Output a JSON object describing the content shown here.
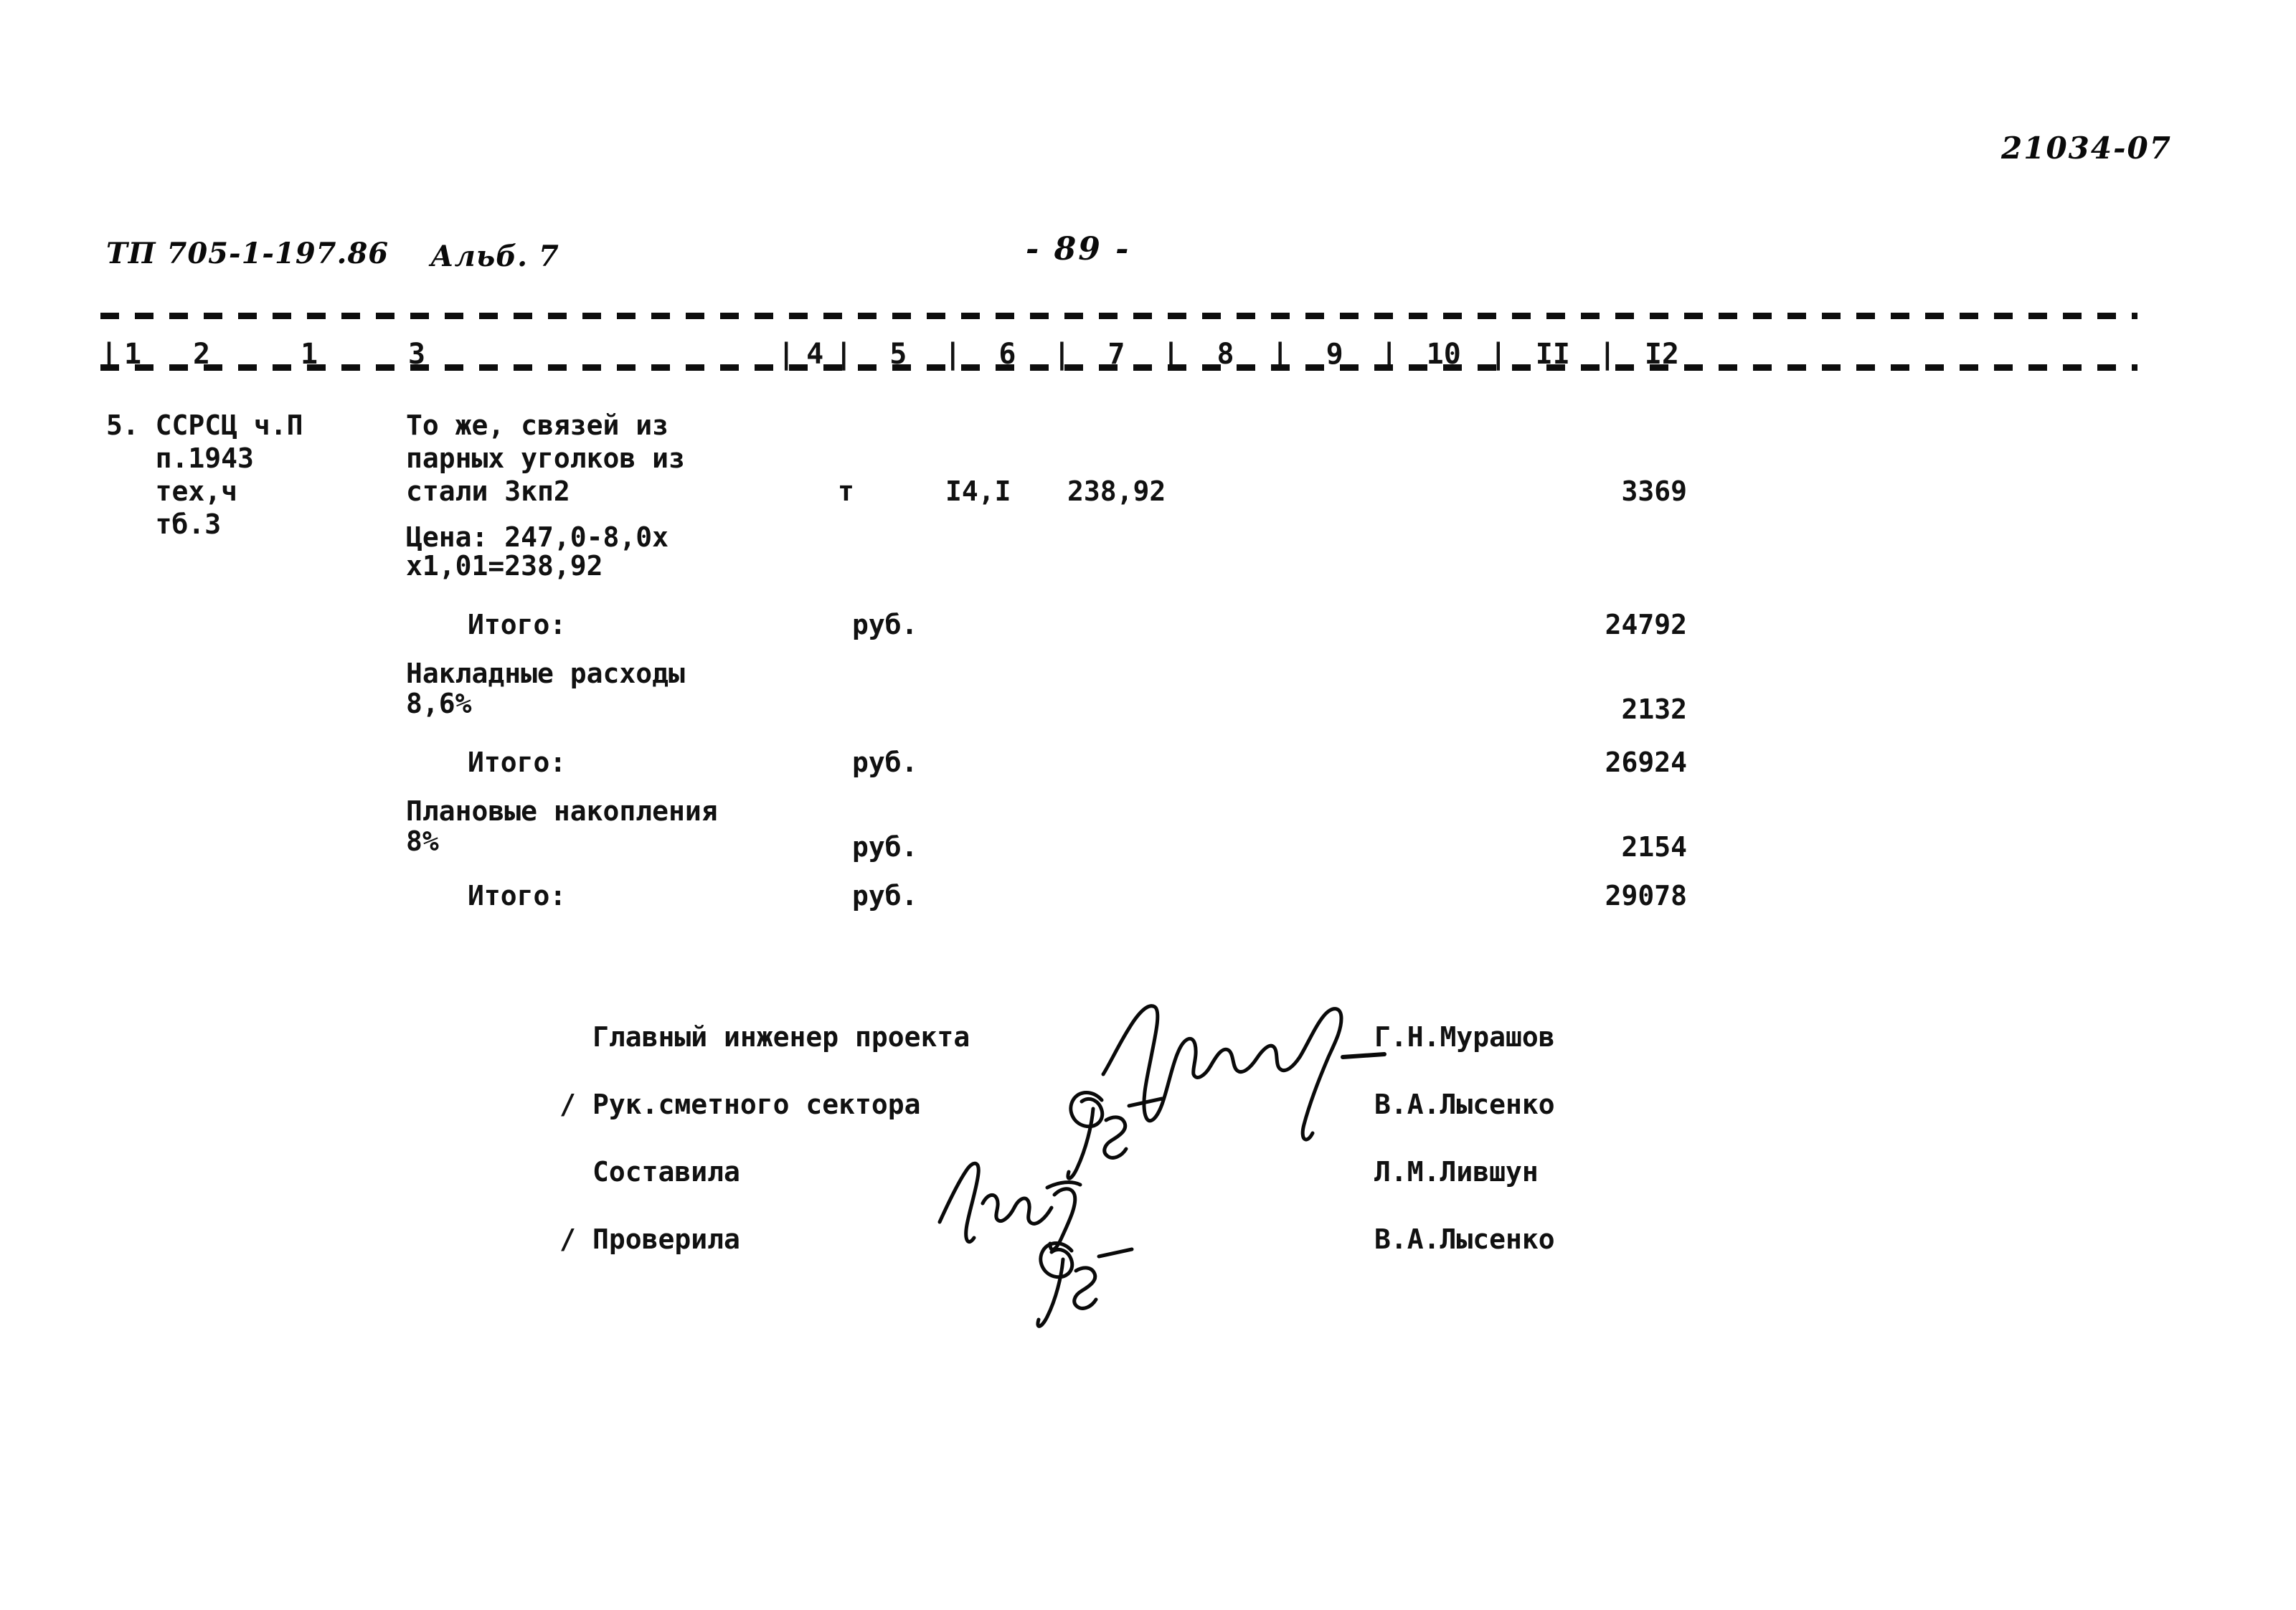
{
  "document": {
    "project_stamp": "ТП 705-1-197.86",
    "album_stamp": "Альб. 7",
    "page_marker": "- 89 -",
    "archive_number": "21034-07"
  },
  "table": {
    "column_numbers": [
      "1",
      "2",
      "1",
      "3",
      "4",
      "5",
      "6",
      "7",
      "8",
      "9",
      "10",
      "II",
      "I2"
    ],
    "separator": "|",
    "rows": [
      {
        "ref": [
          "5. ССРСЦ ч.П",
          "   п.1943",
          "   тех,ч",
          "   тб.3"
        ],
        "description": [
          "То же, связей из",
          "парных уголков из",
          "стали 3кп2"
        ],
        "price_note": [
          "Цена: 247,0-8,0х",
          "х1,01=238,92"
        ],
        "unit": "т",
        "quantity": "I4,I",
        "price": "238,92",
        "amount": "3369"
      }
    ],
    "summary": [
      {
        "label": "Итого:",
        "indent": true,
        "unit": "руб.",
        "amount": "24792"
      },
      {
        "label": "Накладные расходы",
        "sublabel": "8,6%",
        "indent": false,
        "unit": "",
        "amount": "2132"
      },
      {
        "label": "Итого:",
        "indent": true,
        "unit": "руб.",
        "amount": "26924"
      },
      {
        "label": "Плановые накопления",
        "sublabel": "8%",
        "indent": false,
        "unit": "руб.",
        "amount": "2154"
      },
      {
        "label": "Итого:",
        "indent": true,
        "unit": "руб.",
        "amount": "29078"
      }
    ]
  },
  "signatures": {
    "rows": [
      {
        "slash": "",
        "role": "Главный инженер проекта",
        "name": "Г.Н.Мурашов"
      },
      {
        "slash": "/",
        "role": "Рук.сметного сектора",
        "name": "В.А.Лысенко"
      },
      {
        "slash": "",
        "role": "Составила",
        "name": "Л.М.Лившун"
      },
      {
        "slash": "/",
        "role": "Проверила",
        "name": "В.А.Лысенко"
      }
    ]
  }
}
